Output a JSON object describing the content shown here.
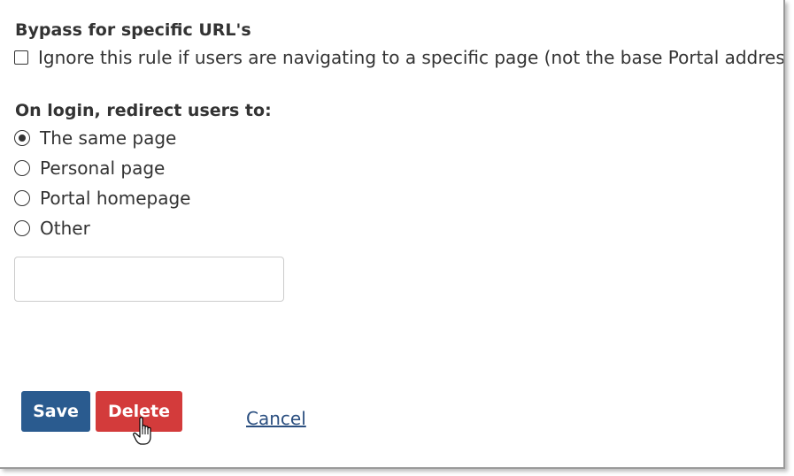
{
  "bypass": {
    "title": "Bypass for specific URL's",
    "checkbox_label": "Ignore this rule if users are navigating to a specific page (not the base Portal address).",
    "checked": false
  },
  "redirect": {
    "title": "On login, redirect users to:",
    "options": [
      {
        "label": "The same page",
        "selected": true
      },
      {
        "label": "Personal page",
        "selected": false
      },
      {
        "label": "Portal homepage",
        "selected": false
      },
      {
        "label": "Other",
        "selected": false
      }
    ],
    "other_value": ""
  },
  "actions": {
    "save_label": "Save",
    "delete_label": "Delete",
    "cancel_label": "Cancel"
  },
  "colors": {
    "save": "#2a5b8f",
    "delete": "#d33b3b",
    "link": "#2b4f80"
  },
  "cursor": {
    "icon": "hand-pointer-icon"
  }
}
